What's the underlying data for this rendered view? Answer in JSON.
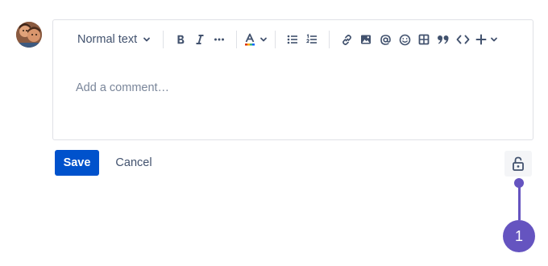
{
  "toolbar": {
    "text_style_label": "Normal text",
    "icons": [
      "chevron-down-icon",
      "bold-icon",
      "italic-icon",
      "more-formatting-icon",
      "text-color-icon",
      "bullet-list-icon",
      "numbered-list-icon",
      "link-icon",
      "image-icon",
      "mention-icon",
      "emoji-icon",
      "table-icon",
      "quote-icon",
      "code-icon",
      "insert-plus-icon"
    ]
  },
  "editor": {
    "placeholder": "Add a comment…"
  },
  "actions": {
    "save_label": "Save",
    "cancel_label": "Cancel"
  },
  "callout": {
    "number": "1"
  },
  "colors": {
    "primary": "#0052cc",
    "callout": "#6554c0",
    "icon": "#42526e",
    "placeholder": "#7a869a",
    "border": "#dfe1e6"
  }
}
